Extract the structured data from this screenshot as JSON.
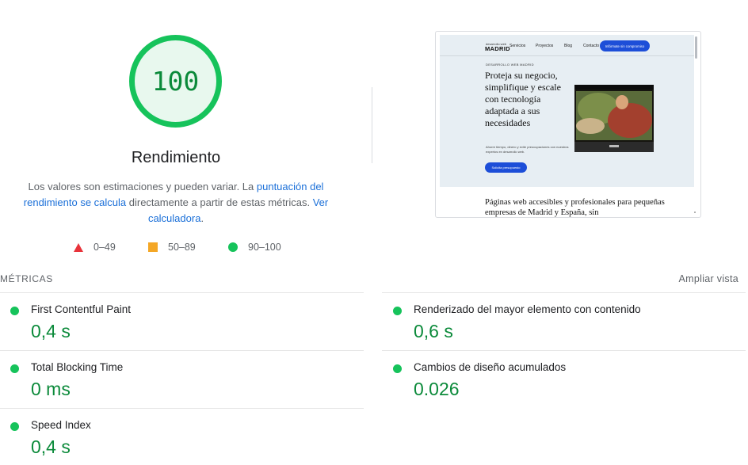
{
  "gauge": {
    "score": "100",
    "title": "Rendimiento",
    "color": "#16c35b",
    "fill": "#e8f8ee"
  },
  "description": {
    "part1": "Los valores son estimaciones y pueden variar. La ",
    "link1": "puntuación del rendimiento se calcula",
    "part2": " directamente a partir de estas métricas. ",
    "link2": "Ver calculadora",
    "part3": "."
  },
  "legend": [
    {
      "icon": "triangle-icon",
      "range": "0–49",
      "color": "#e8333a"
    },
    {
      "icon": "square-icon",
      "range": "50–89",
      "color": "#f4a726"
    },
    {
      "icon": "circle-icon",
      "range": "90–100",
      "color": "#16c35b"
    }
  ],
  "screenshot": {
    "logo_small": "desarrollo web",
    "logo": "MADRID",
    "nav": [
      "Servicios",
      "Proyectos",
      "Blog",
      "Contacto"
    ],
    "cta_top": "Infórmate sin compromiso",
    "kicker": "DESARROLLO WEB MADRID",
    "headline": "Proteja su negocio, simplifique y escale con tecnología adaptada a sus necesidades",
    "sub": "Ahorre tiempo, dinero y evite preocupaciones con nuestros expertos en desarrollo web.",
    "cta": "Solicita presupuesto",
    "bottom": "Páginas web accesibles y profesionales para pequeñas empresas de Madrid y España, sin"
  },
  "metrics": {
    "heading": "MÉTRICAS",
    "expand": "Ampliar vista",
    "items": [
      {
        "label": "First Contentful Paint",
        "value": "0,4 s",
        "status": "good"
      },
      {
        "label": "Renderizado del mayor elemento con contenido",
        "value": "0,6 s",
        "status": "good"
      },
      {
        "label": "Total Blocking Time",
        "value": "0 ms",
        "status": "good"
      },
      {
        "label": "Cambios de diseño acumulados",
        "value": "0.026",
        "status": "good"
      },
      {
        "label": "Speed Index",
        "value": "0,4 s",
        "status": "good"
      }
    ]
  }
}
